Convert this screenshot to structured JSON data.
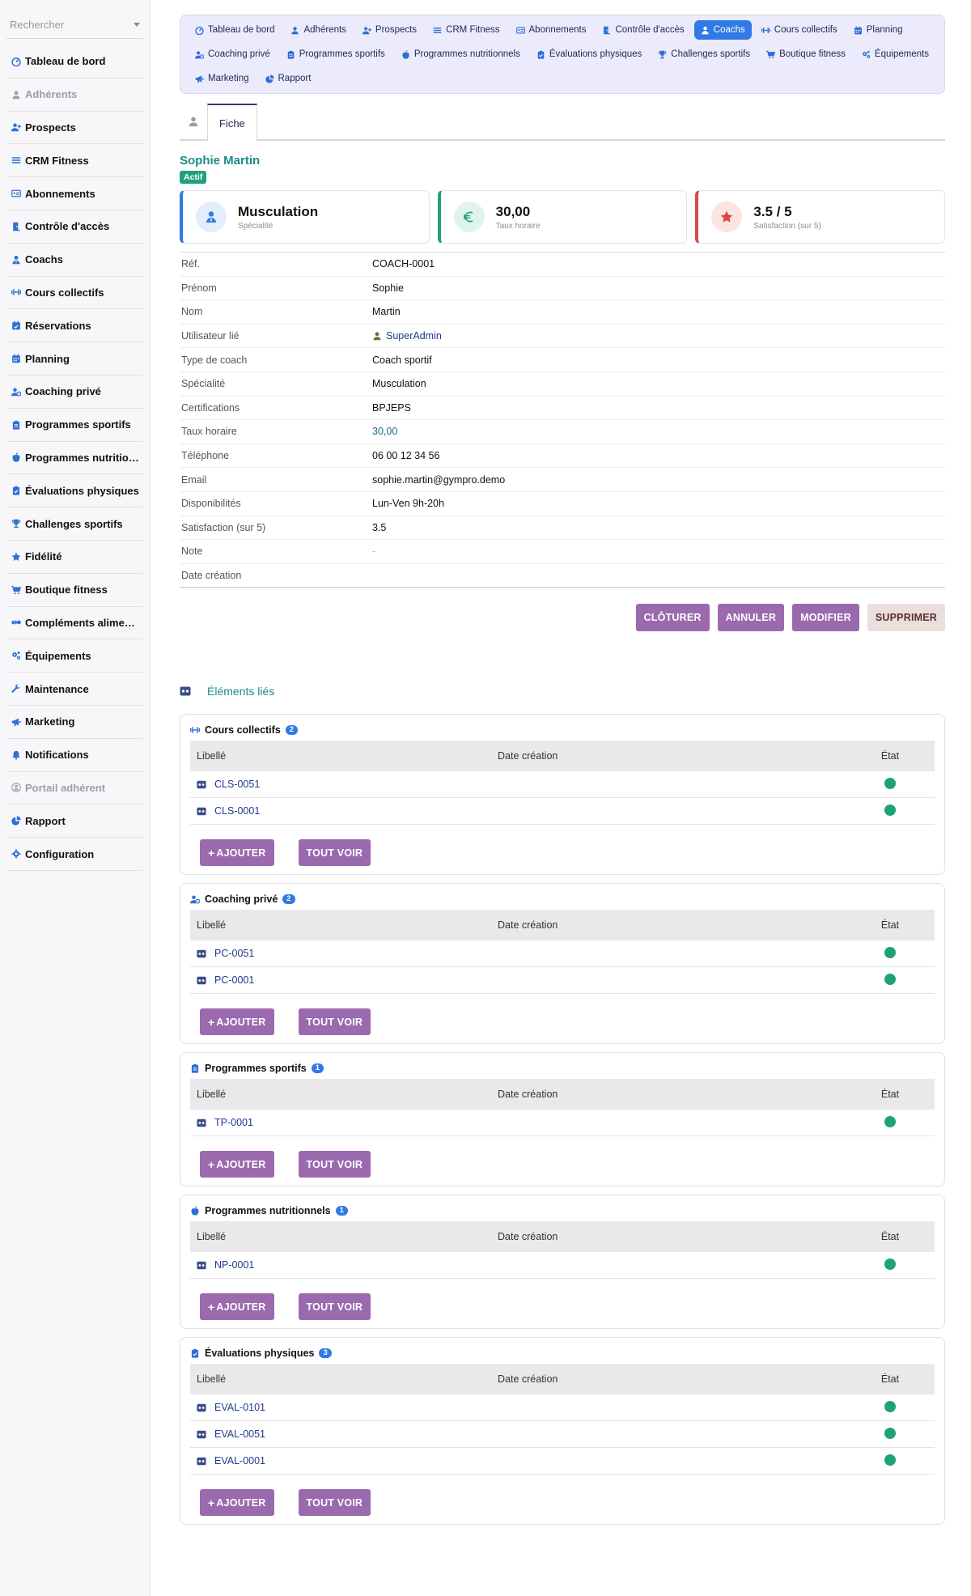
{
  "sidebar": {
    "search_placeholder": "Rechercher",
    "items": [
      {
        "label": "Tableau de bord",
        "icon": "dashboard-icon",
        "muted": false
      },
      {
        "label": "Adhérents",
        "icon": "user-icon",
        "muted": true
      },
      {
        "label": "Prospects",
        "icon": "user-plus-icon",
        "muted": false
      },
      {
        "label": "CRM Fitness",
        "icon": "list-icon",
        "muted": false
      },
      {
        "label": "Abonnements",
        "icon": "id-card-icon",
        "muted": false
      },
      {
        "label": "Contrôle d'accès",
        "icon": "door-icon",
        "muted": false
      },
      {
        "label": "Coachs",
        "icon": "user-tie-icon",
        "muted": false
      },
      {
        "label": "Cours collectifs",
        "icon": "dumbbell-icon",
        "muted": false
      },
      {
        "label": "Réservations",
        "icon": "calendar-check-icon",
        "muted": false
      },
      {
        "label": "Planning",
        "icon": "calendar-icon",
        "muted": false
      },
      {
        "label": "Coaching privé",
        "icon": "user-clock-icon",
        "muted": false
      },
      {
        "label": "Programmes sportifs",
        "icon": "clipboard-icon",
        "muted": false
      },
      {
        "label": "Programmes nutritio…",
        "icon": "apple-icon",
        "muted": false
      },
      {
        "label": "Évaluations physiques",
        "icon": "clipboard-check-icon",
        "muted": false
      },
      {
        "label": "Challenges sportifs",
        "icon": "trophy-icon",
        "muted": false
      },
      {
        "label": "Fidélité",
        "icon": "star-icon",
        "muted": false
      },
      {
        "label": "Boutique fitness",
        "icon": "cart-icon",
        "muted": false
      },
      {
        "label": "Compléments alime…",
        "icon": "pills-icon",
        "muted": false
      },
      {
        "label": "Équipements",
        "icon": "cogs-icon",
        "muted": false
      },
      {
        "label": "Maintenance",
        "icon": "wrench-icon",
        "muted": false
      },
      {
        "label": "Marketing",
        "icon": "megaphone-icon",
        "muted": false
      },
      {
        "label": "Notifications",
        "icon": "bell-icon",
        "muted": false
      },
      {
        "label": "Portail adhérent",
        "icon": "user-circle-icon",
        "muted": true
      },
      {
        "label": "Rapport",
        "icon": "pie-chart-icon",
        "muted": false
      },
      {
        "label": "Configuration",
        "icon": "gear-icon",
        "muted": false
      }
    ]
  },
  "topnav": [
    {
      "label": "Tableau de bord",
      "icon": "dashboard-icon",
      "active": false
    },
    {
      "label": "Adhérents",
      "icon": "user-icon",
      "active": false
    },
    {
      "label": "Prospects",
      "icon": "user-plus-icon",
      "active": false
    },
    {
      "label": "CRM Fitness",
      "icon": "list-icon",
      "active": false
    },
    {
      "label": "Abonnements",
      "icon": "id-card-icon",
      "active": false
    },
    {
      "label": "Contrôle d'accès",
      "icon": "door-icon",
      "active": false
    },
    {
      "label": "Coachs",
      "icon": "user-tie-icon",
      "active": true
    },
    {
      "label": "Cours collectifs",
      "icon": "dumbbell-icon",
      "active": false
    },
    {
      "label": "Planning",
      "icon": "calendar-icon",
      "active": false
    },
    {
      "label": "Coaching privé",
      "icon": "user-clock-icon",
      "active": false
    },
    {
      "label": "Programmes sportifs",
      "icon": "clipboard-icon",
      "active": false
    },
    {
      "label": "Programmes nutritionnels",
      "icon": "apple-icon",
      "active": false
    },
    {
      "label": "Évaluations physiques",
      "icon": "clipboard-check-icon",
      "active": false
    },
    {
      "label": "Challenges sportifs",
      "icon": "trophy-icon",
      "active": false
    },
    {
      "label": "Boutique fitness",
      "icon": "cart-icon",
      "active": false
    },
    {
      "label": "Équipements",
      "icon": "cogs-icon",
      "active": false
    },
    {
      "label": "Marketing",
      "icon": "megaphone-icon",
      "active": false
    },
    {
      "label": "Rapport",
      "icon": "pie-chart-icon",
      "active": false
    }
  ],
  "tabs": {
    "fiche": "Fiche"
  },
  "record": {
    "title": "Sophie Martin",
    "status": "Actif"
  },
  "cards": [
    {
      "value": "Musculation",
      "label": "Spécialité",
      "icon": "user-tie-icon",
      "color": "#2f7ae5",
      "bg": "#e3eefc"
    },
    {
      "value": "30,00",
      "label": "Taux horaire",
      "icon": "euro-icon",
      "color": "#1fa27c",
      "bg": "#dff4ec"
    },
    {
      "value": "3.5 / 5",
      "label": "Satisfaction (sur 5)",
      "icon": "star-icon",
      "color": "#d9493f",
      "bg": "#fbe4e2"
    }
  ],
  "fields": [
    {
      "key": "Réf.",
      "value": "COACH-0001",
      "style": ""
    },
    {
      "key": "Prénom",
      "value": "Sophie",
      "style": ""
    },
    {
      "key": "Nom",
      "value": "Martin",
      "style": ""
    },
    {
      "key": "Utilisateur lié",
      "value": "SuperAdmin",
      "style": "user"
    },
    {
      "key": "Type de coach",
      "value": "Coach sportif",
      "style": ""
    },
    {
      "key": "Spécialité",
      "value": "Musculation",
      "style": ""
    },
    {
      "key": "Certifications",
      "value": "BPJEPS",
      "style": ""
    },
    {
      "key": "Taux horaire",
      "value": "30,00",
      "style": "link"
    },
    {
      "key": "Téléphone",
      "value": "06 00 12 34 56",
      "style": ""
    },
    {
      "key": "Email",
      "value": "sophie.martin@gympro.demo",
      "style": ""
    },
    {
      "key": "Disponibilités",
      "value": "Lun-Ven 9h-20h",
      "style": ""
    },
    {
      "key": "Satisfaction (sur 5)",
      "value": "3.5",
      "style": ""
    },
    {
      "key": "Note",
      "value": "-",
      "style": "dash"
    },
    {
      "key": "Date création",
      "value": "",
      "style": ""
    }
  ],
  "actions": {
    "cloturer": "CLÔTURER",
    "annuler": "ANNULER",
    "modifier": "MODIFIER",
    "supprimer": "SUPPRIMER"
  },
  "linked": {
    "title": "Éléments liés",
    "columns": {
      "label": "Libellé",
      "date": "Date création",
      "state": "État"
    },
    "add_label": "AJOUTER",
    "view_all_label": "TOUT VOIR",
    "blocks": [
      {
        "title": "Cours collectifs",
        "count": "2",
        "icon": "dumbbell-icon",
        "rows": [
          "CLS-0051",
          "CLS-0001"
        ]
      },
      {
        "title": "Coaching privé",
        "count": "2",
        "icon": "user-clock-icon",
        "rows": [
          "PC-0051",
          "PC-0001"
        ]
      },
      {
        "title": "Programmes sportifs",
        "count": "1",
        "icon": "clipboard-icon",
        "rows": [
          "TP-0001"
        ]
      },
      {
        "title": "Programmes nutritionnels",
        "count": "1",
        "icon": "apple-icon",
        "rows": [
          "NP-0001"
        ]
      },
      {
        "title": "Évaluations physiques",
        "count": "3",
        "icon": "clipboard-check-icon",
        "rows": [
          "EVAL-0101",
          "EVAL-0051",
          "EVAL-0001"
        ]
      }
    ]
  },
  "colors": {
    "accent": "#2f7ae5",
    "teal": "#1d8a86",
    "button": "#9b6aae",
    "status_green": "#1fa27c",
    "icon_blue": "#2f6fd6"
  }
}
